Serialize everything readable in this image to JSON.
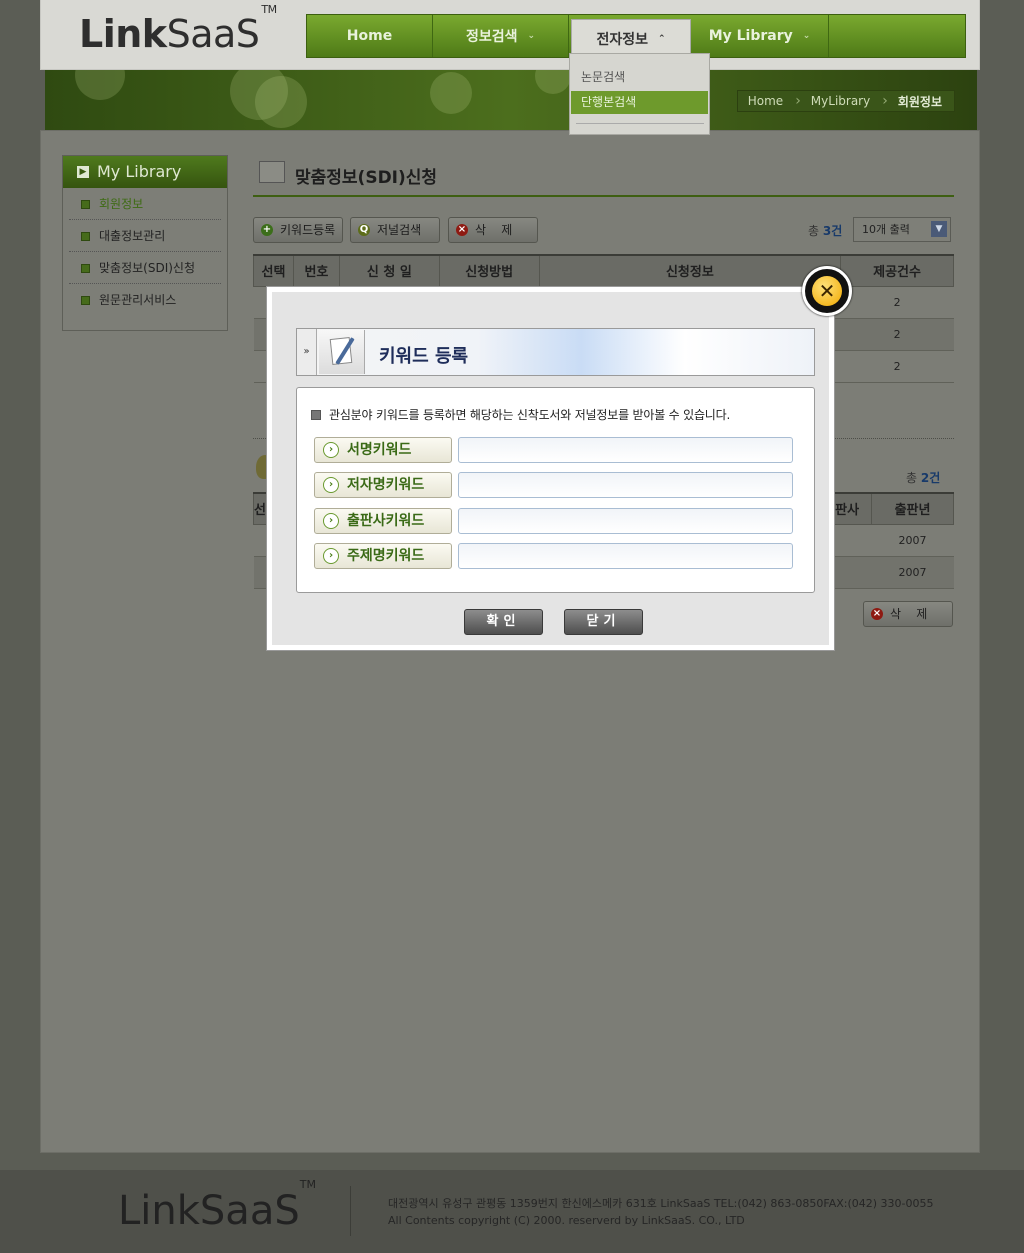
{
  "header": {
    "logo_bold": "Link",
    "logo_light": "SaaS",
    "logo_tm": "TM",
    "nav": [
      {
        "label": "Home",
        "caret": ""
      },
      {
        "label": "정보검색",
        "caret": "⌄"
      },
      {
        "label": "전자정보",
        "caret": "⌃"
      },
      {
        "label": "My Library",
        "caret": "⌄"
      }
    ],
    "submenu": [
      "논문검색",
      "단행본검색"
    ]
  },
  "breadcrumb": [
    "Home",
    "MyLibrary",
    "회원정보"
  ],
  "sidebar": {
    "title": "My Library",
    "items": [
      "회원정보",
      "대출정보관리",
      "맞춤정보(SDI)신청",
      "원문관리서비스"
    ]
  },
  "content": {
    "title": "맞춤정보(SDI)신청",
    "buttons": {
      "register": "키워드등록",
      "journal": "저널검색",
      "delete": "삭    제"
    },
    "total_prefix": "총",
    "total1": "3건",
    "page_size": "10개 출력",
    "table1": {
      "headers": [
        "선택",
        "번호",
        "신 청 일",
        "신청방법",
        "신청정보",
        "제공건수"
      ],
      "rows": [
        {
          "count": "2"
        },
        {
          "count": "2"
        },
        {
          "count": "2"
        }
      ]
    },
    "total2": "2건",
    "table2": {
      "headers": [
        "선",
        "판사",
        "출판년"
      ],
      "rows": [
        {
          "year": "2007"
        },
        {
          "year": "2007"
        }
      ]
    },
    "delete2": "삭    제"
  },
  "popup": {
    "title": "키워드 등록",
    "description": "관심분야 키워드를 등록하면 해당하는 신착도서와 저널정보를 받아볼 수 있습니다.",
    "fields": [
      {
        "label": "서명키워드",
        "value": ""
      },
      {
        "label": "저자명키워드",
        "value": ""
      },
      {
        "label": "출판사키워드",
        "value": ""
      },
      {
        "label": "주제명키워드",
        "value": ""
      }
    ],
    "confirm": "확인",
    "close": "닫기"
  },
  "footer": {
    "logo": "LinkSaaS",
    "logo_tm": "TM",
    "address": "대전광역시 유성구 관평동 1359번지 한신에스메카 631호 LinkSaaS TEL:(042) 863-0850FAX:(042) 330-0055",
    "copyright": "All Contents copyright (C) 2000. reserverd by LinkSaaS. CO., LTD"
  }
}
